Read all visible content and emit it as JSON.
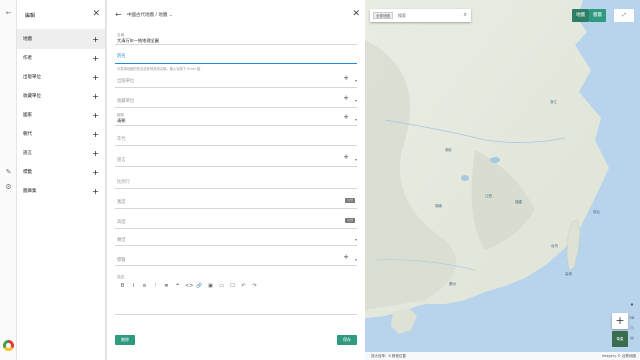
{
  "rail": {
    "icons": [
      "back-arrow-icon",
      "pencil-icon",
      "gear-icon",
      "app-logo"
    ]
  },
  "category_panel": {
    "title": "編輯",
    "items": [
      {
        "label": "地圖",
        "active": true
      },
      {
        "label": "作者",
        "active": false
      },
      {
        "label": "出版單位",
        "active": false
      },
      {
        "label": "收藏單位",
        "active": false
      },
      {
        "label": "國家",
        "active": false
      },
      {
        "label": "朝代",
        "active": false
      },
      {
        "label": "語言",
        "active": false
      },
      {
        "label": "標籤",
        "active": false
      },
      {
        "label": "圖庫集",
        "active": false
      }
    ]
  },
  "form": {
    "breadcrumb": "中國古代地圖 / 地圖",
    "fields": {
      "title": {
        "label": "名稱",
        "value": "大清万年一統地理全圖"
      },
      "alias": {
        "placeholder": "別名"
      },
      "alias_hint": "可選填地圖的別名或其他常用名稱，輸入後按下 Enter 鍵",
      "publisher": {
        "placeholder": "出版單位"
      },
      "collection": {
        "placeholder": "收藏單位"
      },
      "country": {
        "label": "國家",
        "value": "清朝"
      },
      "year": {
        "placeholder": "年代"
      },
      "language": {
        "placeholder": "語言"
      },
      "scale": {
        "placeholder": "比例尺"
      },
      "width": {
        "placeholder": "寬度",
        "unit": "公分"
      },
      "height": {
        "placeholder": "高度",
        "unit": "公分"
      },
      "category": {
        "placeholder": "類型"
      },
      "tags": {
        "placeholder": "標籤"
      },
      "description": {
        "label": "描述"
      }
    },
    "toolbar_glyphs": [
      "B",
      "I",
      "≡",
      "⁝",
      "≣",
      "❝",
      "<>",
      "🔗",
      "▣",
      "▭",
      "☐",
      "↶",
      "↷"
    ],
    "delete_label": "刪除",
    "save_label": "保存"
  },
  "map": {
    "search": {
      "tag": "全部地图",
      "placeholder": "搜索"
    },
    "type_buttons": [
      "地圖",
      "圖層"
    ],
    "labels": [
      "臺北",
      "高雄",
      "台灣",
      "浙江",
      "廣州",
      "福建",
      "江西",
      "湖南",
      "湖北"
    ],
    "zoom_in": "+",
    "minimap_label": "衛星",
    "status_left": "放大倍率：6     數值位置",
    "status_right": "Imagery © 谷歌地圖"
  }
}
